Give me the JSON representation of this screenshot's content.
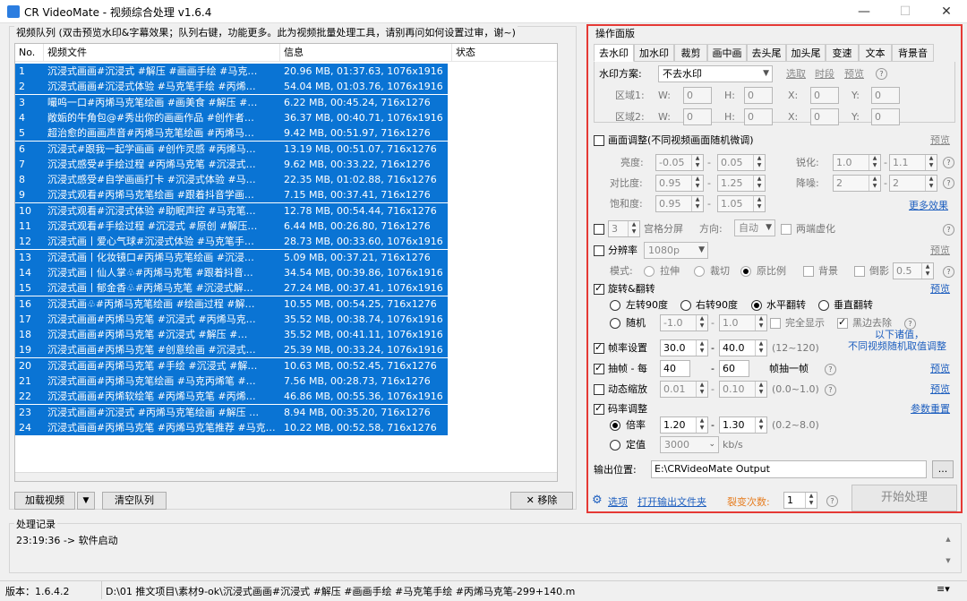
{
  "window": {
    "title": "CR VideoMate - 视频综合处理 v1.6.4",
    "min": "—",
    "max": "☐",
    "close": "✕"
  },
  "queue": {
    "title": "视频队列 (双击预览水印&字幕效果；队列右键，功能更多。此为视频批量处理工具，请别再问如何设置过审，谢~)",
    "headers": [
      "No.",
      "视频文件",
      "信息",
      "状态"
    ],
    "rows": [
      [
        "1",
        "沉浸式画画#沉浸式 #解压 #画画手绘 #马克…",
        "20.96 MB, 01:37.63, 1076x1916"
      ],
      [
        "2",
        "沉浸式画画#沉浸式体验 #马克笔手绘 #丙烯…",
        "54.04 MB, 01:03.76, 1076x1916"
      ],
      [
        "3",
        "嘬呜一口#丙烯马克笔绘画 #画美食 #解压 #…",
        "6.22 MB, 00:45.24, 716x1276"
      ],
      [
        "4",
        "敞姤的牛角包@#秀出你的画画作品 #创作者…",
        "36.37 MB, 00:40.71, 1076x1916"
      ],
      [
        "5",
        "超治愈的画画声音#丙烯马克笔绘画 #丙烯马…",
        "9.42 MB, 00:51.97, 716x1276"
      ],
      [
        "6",
        "沉浸式#跟我一起学画画 #创作灵感 #丙烯马…",
        "13.19 MB, 00:51.07, 716x1276"
      ],
      [
        "7",
        "沉浸式感受#手绘过程 #丙烯马克笔 #沉浸式…",
        "9.62 MB, 00:33.22, 716x1276"
      ],
      [
        "8",
        "沉浸式感受#自学画画打卡 #沉浸式体验 #马…",
        "22.35 MB, 01:02.88, 716x1276"
      ],
      [
        "9",
        "沉浸式观看#丙烯马克笔绘画 #跟着抖音学画…",
        "7.15 MB, 00:37.41, 716x1276"
      ],
      [
        "10",
        "沉浸式观看#沉浸式体验 #助眠声控 #马克笔…",
        "12.78 MB, 00:54.44, 716x1276"
      ],
      [
        "11",
        "沉浸式观看#手绘过程 #沉浸式 #原创 #解压…",
        "6.44 MB, 00:26.80, 716x1276"
      ],
      [
        "12",
        "沉浸式画丨爱心气球#沉浸式体验 #马克笔手…",
        "28.73 MB, 00:33.60, 1076x1916"
      ],
      [
        "13",
        "沉浸式画丨化妆镜口#丙烯马克笔绘画 #沉浸…",
        "5.09 MB, 00:37.21, 716x1276"
      ],
      [
        "14",
        "沉浸式画丨仙人掌♧#丙烯马克笔 #跟着抖音…",
        "34.54 MB, 00:39.86, 1076x1916"
      ],
      [
        "15",
        "沉浸式画丨郁金香♧#丙烯马克笔 #沉浸式解…",
        "27.24 MB, 00:37.41, 1076x1916"
      ],
      [
        "16",
        "沉浸式画♧#丙烯马克笔绘画 #绘画过程 #解…",
        "10.55 MB, 00:54.25, 716x1276"
      ],
      [
        "17",
        "沉浸式画画#丙烯马克笔 #沉浸式 #丙烯马克…",
        "35.52 MB, 00:38.74, 1076x1916"
      ],
      [
        "18",
        "沉浸式画画#丙烯马克笔 #沉浸式 #解压 #…",
        "35.52 MB, 00:41.11, 1076x1916"
      ],
      [
        "19",
        "沉浸式画画#丙烯马克笔 #创意绘画 #沉浸式…",
        "25.39 MB, 00:33.24, 1076x1916"
      ],
      [
        "20",
        "沉浸式画画#丙烯马克笔 #手绘 #沉浸式 #解…",
        "10.63 MB, 00:52.45, 716x1276"
      ],
      [
        "21",
        "沉浸式画画#丙烯马克笔绘画 #马克丙烯笔 #…",
        "7.56 MB, 00:28.73, 716x1276"
      ],
      [
        "22",
        "沉浸式画画#丙烯软绘笔 #丙烯马克笔 #丙烯…",
        "46.86 MB, 00:55.36, 1076x1916"
      ],
      [
        "23",
        "沉浸式画画#沉浸式 #丙烯马克笔绘画 #解压 …",
        "8.94 MB, 00:35.20, 716x1276"
      ],
      [
        "24",
        "沉浸式画画#丙烯马克笔 #丙烯马克笔推荐 #马克…",
        "10.22 MB, 00:52.58, 716x1276"
      ]
    ],
    "load_btn": "加载视频",
    "dd_btn": "▼",
    "clear_btn": "清空队列",
    "remove_btn": "移除"
  },
  "panel": {
    "title": "操作面版",
    "tabs": [
      "去水印",
      "加水印",
      "裁剪",
      "画中画",
      "去头尾",
      "加头尾",
      "变速",
      "文本",
      "背景音"
    ],
    "wm_scheme_label": "水印方案:",
    "wm_scheme_value": "不去水印",
    "pick": "选取",
    "period": "时段",
    "preview": "预览",
    "area1": "区域1:",
    "area2": "区域2:",
    "w": "W:",
    "h": "H:",
    "x": "X:",
    "y": "Y:",
    "zero": "0",
    "adjust_label": "画面调整(不同视频画面随机微调)",
    "adjust_preview": "预览",
    "brightness": "亮度:",
    "b1": "-0.05",
    "b2": "0.05",
    "sharpen": "锐化:",
    "s1": "1.0",
    "s2": "1.1",
    "contrast": "对比度:",
    "c1": "0.95",
    "c2": "1.25",
    "denoise": "降噪:",
    "d1": "2",
    "d2": "2",
    "saturation": "饱和度:",
    "sa1": "0.95",
    "sa2": "1.05",
    "more_effects": "更多效果",
    "grid_num": "3",
    "grid_label": "宫格分屏",
    "direction": "方向:",
    "direction_value": "自动",
    "blur_ends": "两端虚化",
    "resolution": "分辨率",
    "res_value": "1080p",
    "res_preview": "预览",
    "mode": "模式:",
    "stretch": "拉伸",
    "crop": "裁切",
    "keep_ratio": "原比例",
    "background": "背景",
    "shadow": "倒影",
    "shadow_val": "0.5",
    "rotate_label": "旋转&翻转",
    "rotate_preview": "预览",
    "rot_left": "左转90度",
    "rot_right": "右转90度",
    "flip_h": "水平翻转",
    "flip_v": "垂直翻转",
    "random": "随机",
    "r1": "-1.0",
    "r2": "1.0",
    "full_show": "完全显示",
    "black_edge": "黑边去除",
    "note1": "以下诸值，",
    "note2": "不同视频随机取值调整",
    "fps_label": "帧率设置",
    "fps1": "30.0",
    "fps2": "40.0",
    "fps_range": "(12~120)",
    "drop_label": "抽帧 - 每",
    "drop1": "40",
    "drop2": "60",
    "drop_suffix": "帧抽一帧",
    "drop_preview": "预览",
    "zoom_label": "动态缩放",
    "z1": "0.01",
    "z2": "0.10",
    "zoom_range": "(0.0~1.0)",
    "zoom_preview": "预览",
    "bitrate_label": "码率调整",
    "bitrate_reset": "参数重置",
    "ratio": "倍率",
    "br1": "1.20",
    "br2": "1.30",
    "br_range": "(0.2~8.0)",
    "fixed": "定值",
    "fixed_val": "3000",
    "kbs": "kb/s",
    "output_label": "输出位置:",
    "output_path": "E:\\CRVideoMate Output",
    "browse": "...",
    "options": "选项",
    "open_folder": "打开输出文件夹",
    "fission": "裂变次数:",
    "fission_val": "1",
    "start": "开始处理",
    "dash": "-"
  },
  "log": {
    "title": "处理记录",
    "entry": "23:19:36 -> 软件启动"
  },
  "status": {
    "version": "版本：1.6.4.2",
    "path": "D:\\01 推文项目\\素材9-ok\\沉浸式画画#沉浸式 #解压 #画画手绘 #马克笔手绘 #丙烯马克笔-299+140.m"
  }
}
